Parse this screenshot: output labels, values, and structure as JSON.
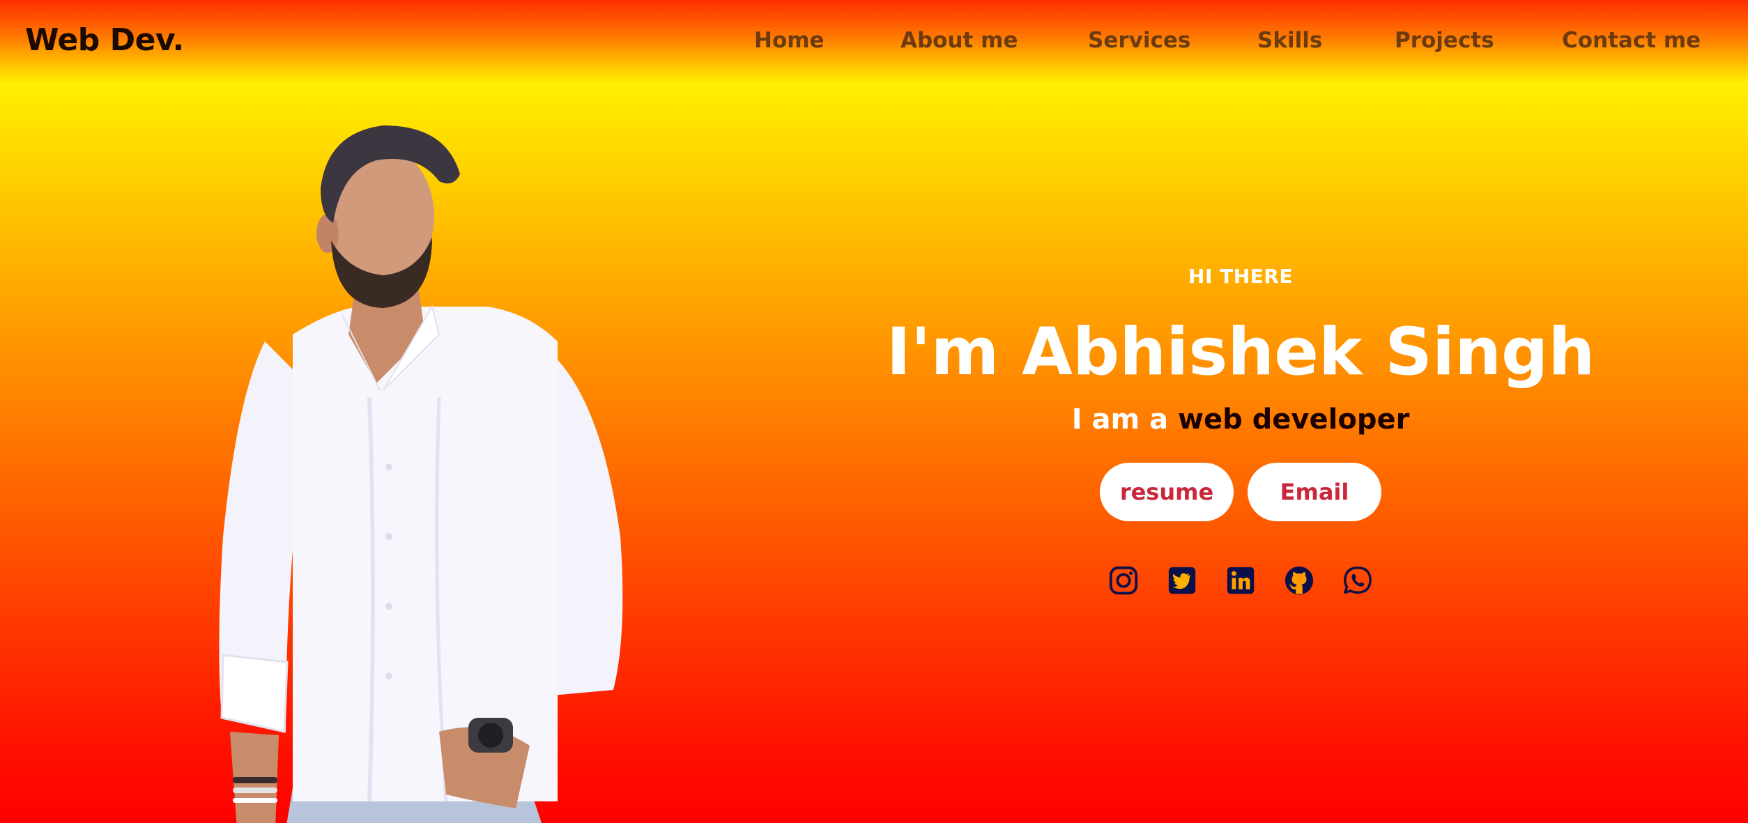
{
  "navbar": {
    "brand": "Web Dev.",
    "links": [
      {
        "label": "Home"
      },
      {
        "label": "About me"
      },
      {
        "label": "Services"
      },
      {
        "label": "Skills"
      },
      {
        "label": "Projects"
      },
      {
        "label": "Contact me"
      }
    ]
  },
  "hero": {
    "greeting": "HI THERE",
    "name": "I'm Abhishek Singh",
    "tagline_prefix": "I am a ",
    "tagline_role": "web developer",
    "buttons": {
      "resume": "resume",
      "email": "Email"
    },
    "socials": [
      {
        "icon": "instagram-icon"
      },
      {
        "icon": "twitter-icon"
      },
      {
        "icon": "linkedin-icon"
      },
      {
        "icon": "github-icon"
      },
      {
        "icon": "whatsapp-icon"
      }
    ],
    "colors": {
      "button_text": "#c8283a",
      "icon_color": "#0b0f4a",
      "role_text": "#1a0000"
    }
  }
}
